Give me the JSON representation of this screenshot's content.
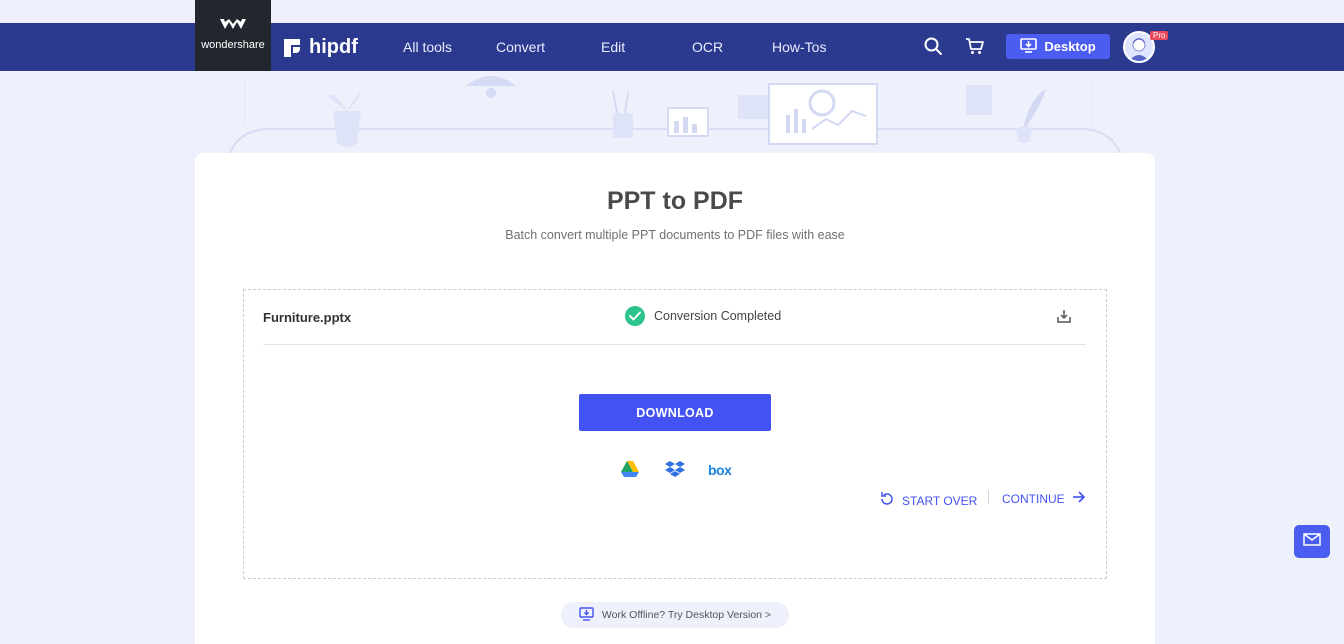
{
  "header": {
    "ws_logo_text": "wondershare",
    "brand": "hipdf",
    "nav": [
      "All tools",
      "Convert",
      "Edit",
      "OCR",
      "How-Tos"
    ],
    "desktop_label": "Desktop",
    "pro_badge": "Pro"
  },
  "main": {
    "title": "PPT to PDF",
    "subtitle": "Batch convert multiple PPT documents to PDF files with ease",
    "file": {
      "name": "Furniture.pptx",
      "status": "Conversion Completed"
    },
    "download_label": "DOWNLOAD",
    "cloud_services": [
      "google-drive-icon",
      "dropbox-icon",
      "box-icon"
    ],
    "box_label": "box",
    "start_over_label": "START OVER",
    "continue_label": "CONTINUE",
    "offline_label": "Work Offline? Try Desktop Version >"
  },
  "colors": {
    "nav_bg": "#2b3a8f",
    "accent": "#4352f3",
    "success": "#2cc48a",
    "page_bg": "#eef0fb"
  }
}
